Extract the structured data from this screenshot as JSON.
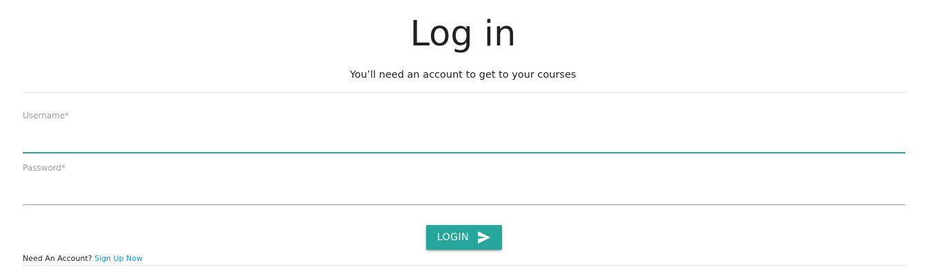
{
  "header": {
    "title": "Log in",
    "subtitle": "You’ll need an account to get to your courses"
  },
  "form": {
    "username": {
      "label": "Username*",
      "value": ""
    },
    "password": {
      "label": "Password*",
      "value": ""
    },
    "login_button": {
      "label": "LOGIN",
      "icon": "send-icon"
    }
  },
  "footer": {
    "prompt": "Need An Account?",
    "signup_link": "Sign Up Now"
  },
  "colors": {
    "accent": "#26a69a",
    "link": "#039be5",
    "label": "#9e9e9e",
    "divider": "#e0e0e0"
  }
}
